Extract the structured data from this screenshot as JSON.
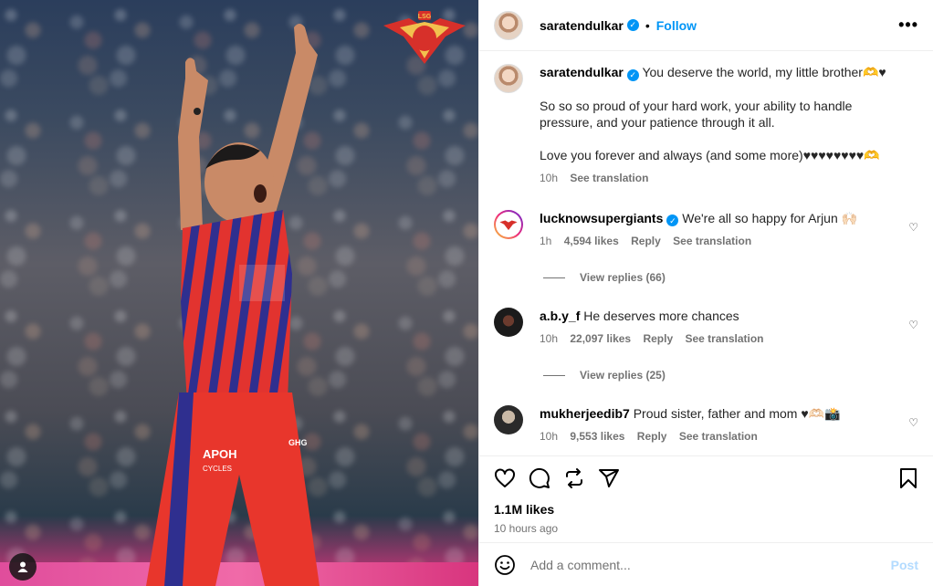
{
  "post": {
    "author": "saratendulkar",
    "follow_label": "Follow",
    "dot": "•",
    "more_label": "•••",
    "verified_mark": "✓"
  },
  "caption": {
    "username": "saratendulkar",
    "line1": "You deserve the world, my little brother🫶♥",
    "line2": "So so so proud of your hard work, your ability to handle pressure, and your patience through it all.",
    "line3": "Love you forever and always (and some more)♥♥♥♥♥♥♥♥🫶",
    "time": "10h",
    "see_translation": "See translation"
  },
  "comments": [
    {
      "username": "lucknowsupergiants",
      "verified": true,
      "text": "We're all so happy for Arjun 🙌🏻",
      "time": "1h",
      "likes": "4,594 likes",
      "reply": "Reply",
      "see_translation": "See translation",
      "view_replies": "View replies (66)"
    },
    {
      "username": "a.b.y_f",
      "text": "He deserves more chances",
      "time": "10h",
      "likes": "22,097 likes",
      "reply": "Reply",
      "see_translation": "See translation",
      "view_replies": "View replies (25)"
    },
    {
      "username": "mukherjeedib7",
      "text": "Proud sister, father and mom ♥🫶🏻📸",
      "time": "10h",
      "likes": "9,553 likes",
      "reply": "Reply",
      "see_translation": "See translation"
    }
  ],
  "stats": {
    "likes": "1.1M likes",
    "posted": "10 hours ago"
  },
  "composer": {
    "placeholder": "Add a comment...",
    "post_label": "Post"
  },
  "icons": {
    "like": "heart-icon",
    "comment": "comment-icon",
    "repost": "repost-icon",
    "share": "share-icon",
    "save": "bookmark-icon",
    "emoji": "emoji-icon",
    "comment_like": "heart-icon",
    "user_tag": "user-icon"
  },
  "colors": {
    "accent": "#0095f6",
    "post_disabled": "#b3dbff",
    "meta": "#737373"
  }
}
